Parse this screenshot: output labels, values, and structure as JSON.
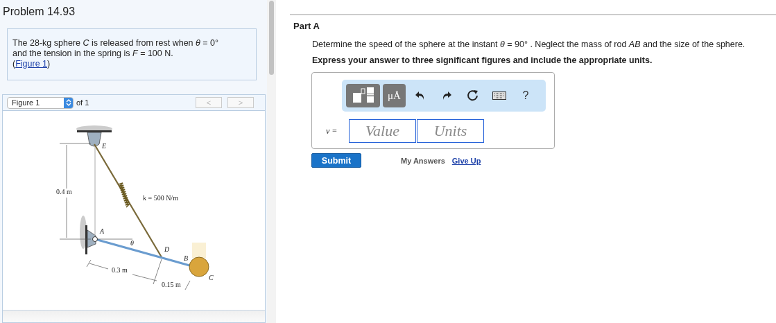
{
  "problem": {
    "title": "Problem 14.93",
    "statement_lines": [
      "The 28-kg sphere *C* is released from rest when *θ* = 0°",
      "and the tension in the spring is *F* = 100 N."
    ],
    "link_open": "(",
    "figure_link": "Figure 1",
    "link_close": ")"
  },
  "figure_nav": {
    "select": "Figure 1",
    "count": "of 1",
    "prev": {
      "label": "<",
      "disabled": true
    },
    "next": {
      "label": ">",
      "disabled": true
    }
  },
  "figure": {
    "labels": [
      {
        "kind": "point",
        "text": "E"
      },
      {
        "kind": "dimension",
        "text": "0.4 m"
      },
      {
        "kind": "spring",
        "text": "k = 500 N/m"
      },
      {
        "kind": "point",
        "text": "A"
      },
      {
        "kind": "angle",
        "text": "θ"
      },
      {
        "kind": "point",
        "text": "D"
      },
      {
        "kind": "point",
        "text": "B"
      },
      {
        "kind": "point",
        "text": "C"
      },
      {
        "kind": "dimension",
        "text": "0.3 m"
      },
      {
        "kind": "dimension",
        "text": "0.15 m"
      }
    ]
  },
  "part": {
    "title": "Part A",
    "question": "Determine the speed of the sphere at the instant *θ* = 90° . Neglect the mass of rod *AB* and the size of the sphere.",
    "instruction": "Express your answer to three significant figures and include the appropriate units.",
    "toolbar": [
      {
        "kind": "templates"
      },
      {
        "kind": "symbols",
        "label": "μÅ"
      },
      {
        "kind": "undo"
      },
      {
        "kind": "redo"
      },
      {
        "kind": "reset"
      },
      {
        "kind": "keyboard"
      },
      {
        "kind": "help",
        "label": "?"
      }
    ],
    "answer": {
      "variable": "v =",
      "value_placeholder": "Value",
      "units_placeholder": "Units"
    },
    "submit": "Submit",
    "my_answers": "My Answers",
    "give_up": "Give Up"
  }
}
